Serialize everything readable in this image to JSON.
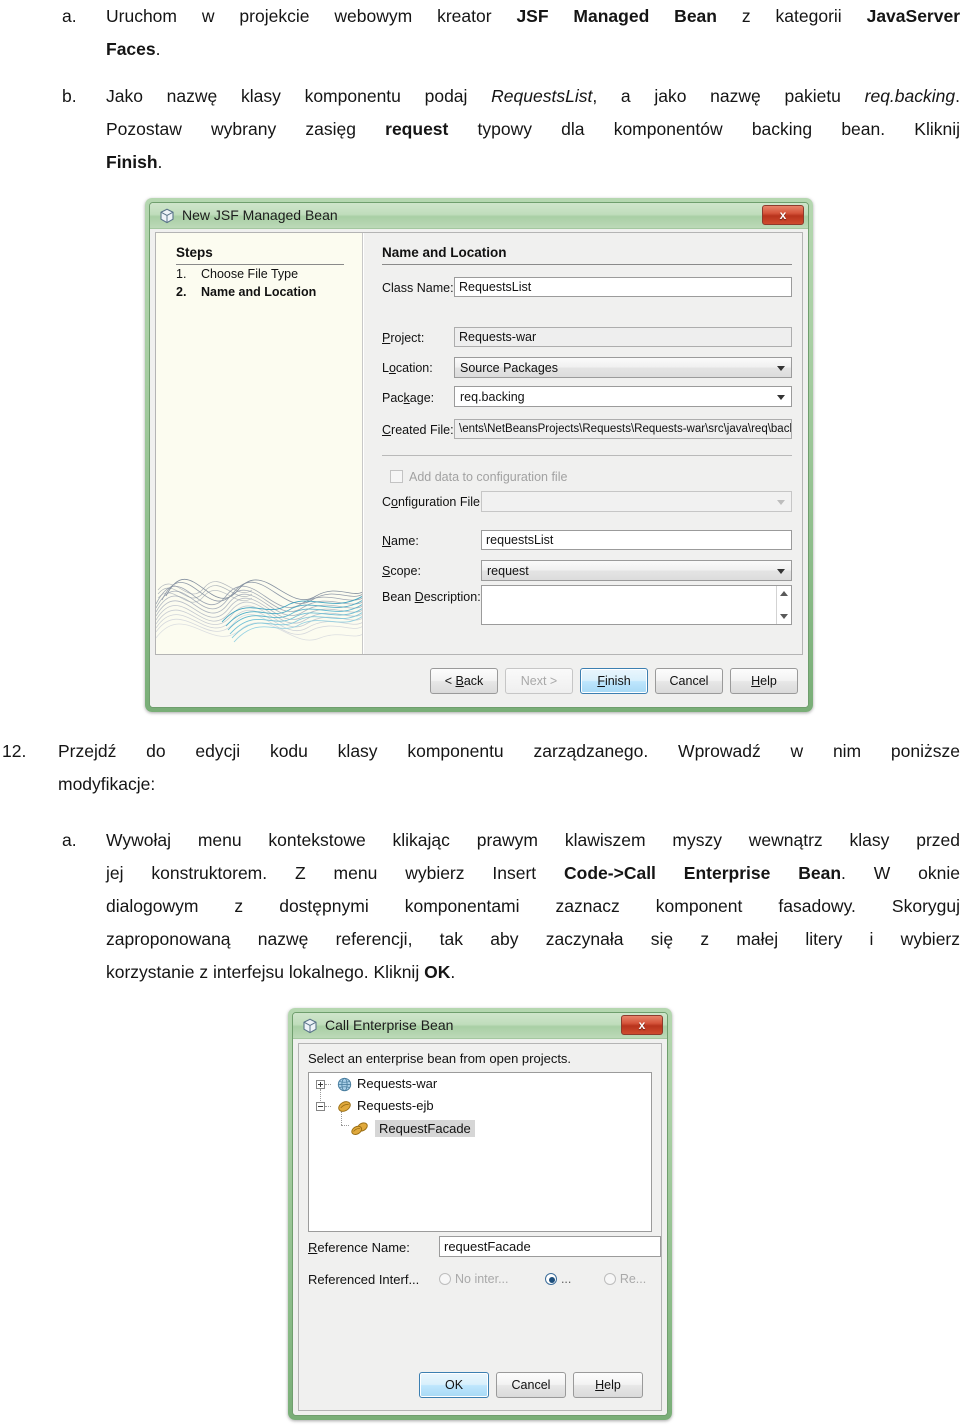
{
  "document": {
    "item_a": {
      "marker": "a.",
      "line1_pre": "Uruchom w projekcie webowym kreator ",
      "line1_bold": "JSF Managed Bean",
      "line1_mid": " z kategorii ",
      "line1_bold2": "JavaServer",
      "line2_bold": "Faces",
      "line2_post": "."
    },
    "item_b": {
      "marker": "b.",
      "l1_a": "Jako nazwę klasy komponentu podaj ",
      "l1_i": "RequestsList",
      "l1_b": ", a jako nazwę pakietu ",
      "l1_i2": "req.backing",
      "l1_c": ".",
      "l2_a": "Pozostaw wybrany zasięg ",
      "l2_b": "request",
      "l2_c": " typowy dla komponentów backing bean. Kliknij",
      "l3_b": "Finish",
      "l3_c": "."
    },
    "item_12": {
      "marker": "12.",
      "l1": "Przejdź do edycji kodu klasy komponentu zarządzanego. Wprowadź w nim poniższe",
      "l2": "modyfikacje:"
    },
    "item_12a": {
      "marker": "a.",
      "l1": "Wywołaj menu kontekstowe klikając prawym klawiszem myszy wewnątrz klasy przed",
      "l2_a": "jej konstruktorem. Z menu wybierz Insert ",
      "l2_b": "Code->Call Enterprise Bean",
      "l2_c": ". W oknie",
      "l3": "dialogowym z dostępnymi komponentami zaznacz komponent fasadowy. Skoryguj",
      "l4": "zaproponowaną nazwę referencji, tak aby zaczynała się z małej litery i wybierz",
      "l5_a": "korzystanie z interfejsu lokalnego. Kliknij ",
      "l5_b": "OK",
      "l5_c": "."
    }
  },
  "wizard": {
    "title": "New JSF Managed Bean",
    "close_label": "x",
    "steps_heading": "Steps",
    "steps": [
      {
        "num": "1.",
        "label": "Choose File Type",
        "active": false
      },
      {
        "num": "2.",
        "label": "Name and Location",
        "active": true
      }
    ],
    "panel_heading": "Name and Location",
    "fields": {
      "class_name_label": "Class Name:",
      "class_name_value": "RequestsList",
      "project_label": "Project:",
      "project_value": "Requests-war",
      "location_label": "Location:",
      "location_value": "Source Packages",
      "package_label": "Package:",
      "package_value": "req.backing",
      "created_file_label": "Created File:",
      "created_file_value": "\\ents\\NetBeansProjects\\Requests\\Requests-war\\src\\java\\req\\back",
      "add_data_label": "Add data to configuration file",
      "config_file_label": "Configuration File:",
      "config_file_value": "",
      "name_label": "Name:",
      "name_value": "requestsList",
      "scope_label": "Scope:",
      "scope_value": "request",
      "bean_desc_label": "Bean Description:",
      "bean_desc_value": ""
    },
    "buttons": {
      "back": "< Back",
      "next": "Next >",
      "finish": "Finish",
      "cancel": "Cancel",
      "help": "Help"
    }
  },
  "call_bean": {
    "title": "Call Enterprise Bean",
    "close_label": "x",
    "prompt": "Select an enterprise bean from open projects.",
    "tree": [
      {
        "label": "Requests-war",
        "icon": "globe-icon",
        "expander": "plus",
        "selected": false
      },
      {
        "label": "Requests-ejb",
        "icon": "bean-icon",
        "expander": "minus",
        "selected": false
      },
      {
        "label": "RequestFacade",
        "icon": "beans-icon",
        "expander": "none",
        "selected": true
      }
    ],
    "reference_name_label": "Reference Name:",
    "reference_name_value": "requestFacade",
    "referenced_interface_label": "Referenced Interf...",
    "radios": [
      {
        "label": "No inter...",
        "selected": false,
        "disabled": true
      },
      {
        "label": "...",
        "selected": true,
        "disabled": false
      },
      {
        "label": "Re...",
        "selected": false,
        "disabled": true
      }
    ],
    "buttons": {
      "ok": "OK",
      "cancel": "Cancel",
      "help": "Help"
    }
  },
  "colors": {
    "window_frame_green": "#8dbd8a",
    "close_red": "#b8331c",
    "default_button_blue": "#3c7fb1",
    "steps_panel_cream": "#fcfcf0",
    "selection_gray": "#d6d6d6"
  }
}
